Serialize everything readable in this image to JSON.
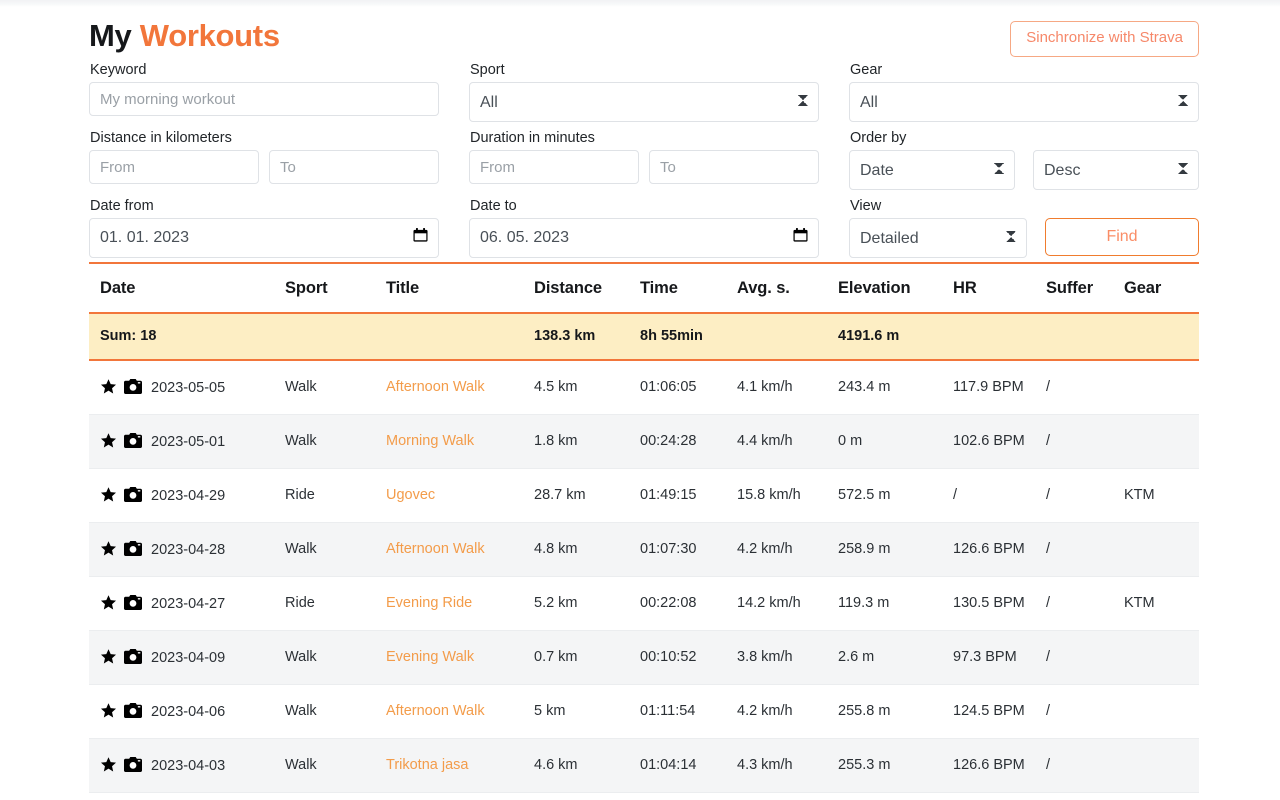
{
  "header": {
    "title_first": "My",
    "title_accent": "Workouts",
    "strava_button": "Sinchronize with Strava"
  },
  "filters": {
    "keyword": {
      "label": "Keyword",
      "placeholder": "My morning workout",
      "value": ""
    },
    "sport": {
      "label": "Sport",
      "value": "All"
    },
    "gear": {
      "label": "Gear",
      "value": "All"
    },
    "distance": {
      "label": "Distance in kilometers",
      "from_placeholder": "From",
      "to_placeholder": "To",
      "from_value": "",
      "to_value": ""
    },
    "duration": {
      "label": "Duration in minutes",
      "from_placeholder": "From",
      "to_placeholder": "To",
      "from_value": "",
      "to_value": ""
    },
    "order_by": {
      "label": "Order by",
      "field_value": "Date",
      "direction_value": "Desc"
    },
    "date_from": {
      "label": "Date from",
      "value": "01. 01. 2023"
    },
    "date_to": {
      "label": "Date to",
      "value": "06. 05. 2023"
    },
    "view": {
      "label": "View",
      "value": "Detailed"
    },
    "find_button": "Find"
  },
  "table": {
    "columns": [
      "Date",
      "Sport",
      "Title",
      "Distance",
      "Time",
      "Avg. s.",
      "Elevation",
      "HR",
      "Suffer",
      "Gear"
    ],
    "summary": {
      "label": "Sum: 18",
      "distance": "138.3 km",
      "time": "8h 55min",
      "elevation": "4191.6 m"
    },
    "rows": [
      {
        "date": "2023-05-05",
        "sport": "Walk",
        "title": "Afternoon Walk",
        "distance": "4.5 km",
        "time": "01:06:05",
        "avg": "4.1 km/h",
        "elevation": "243.4 m",
        "hr": "117.9 BPM",
        "suffer": "/",
        "gear": ""
      },
      {
        "date": "2023-05-01",
        "sport": "Walk",
        "title": "Morning Walk",
        "distance": "1.8 km",
        "time": "00:24:28",
        "avg": "4.4 km/h",
        "elevation": "0 m",
        "hr": "102.6 BPM",
        "suffer": "/",
        "gear": ""
      },
      {
        "date": "2023-04-29",
        "sport": "Ride",
        "title": "Ugovec",
        "distance": "28.7 km",
        "time": "01:49:15",
        "avg": "15.8 km/h",
        "elevation": "572.5 m",
        "hr": "/",
        "suffer": "/",
        "gear": "KTM"
      },
      {
        "date": "2023-04-28",
        "sport": "Walk",
        "title": "Afternoon Walk",
        "distance": "4.8 km",
        "time": "01:07:30",
        "avg": "4.2 km/h",
        "elevation": "258.9 m",
        "hr": "126.6 BPM",
        "suffer": "/",
        "gear": ""
      },
      {
        "date": "2023-04-27",
        "sport": "Ride",
        "title": "Evening Ride",
        "distance": "5.2 km",
        "time": "00:22:08",
        "avg": "14.2 km/h",
        "elevation": "119.3 m",
        "hr": "130.5 BPM",
        "suffer": "/",
        "gear": "KTM"
      },
      {
        "date": "2023-04-09",
        "sport": "Walk",
        "title": "Evening Walk",
        "distance": "0.7 km",
        "time": "00:10:52",
        "avg": "3.8 km/h",
        "elevation": "2.6 m",
        "hr": "97.3 BPM",
        "suffer": "/",
        "gear": ""
      },
      {
        "date": "2023-04-06",
        "sport": "Walk",
        "title": "Afternoon Walk",
        "distance": "5 km",
        "time": "01:11:54",
        "avg": "4.2 km/h",
        "elevation": "255.8 m",
        "hr": "124.5 BPM",
        "suffer": "/",
        "gear": ""
      },
      {
        "date": "2023-04-03",
        "sport": "Walk",
        "title": "Trikotna jasa",
        "distance": "4.6 km",
        "time": "01:04:14",
        "avg": "4.3 km/h",
        "elevation": "255.3 m",
        "hr": "126.6 BPM",
        "suffer": "/",
        "gear": ""
      }
    ]
  },
  "colors": {
    "accent": "#f2763b",
    "title_link": "#f39c4a",
    "summary_bg": "#fdeec4",
    "strava_border": "#f6a884"
  }
}
